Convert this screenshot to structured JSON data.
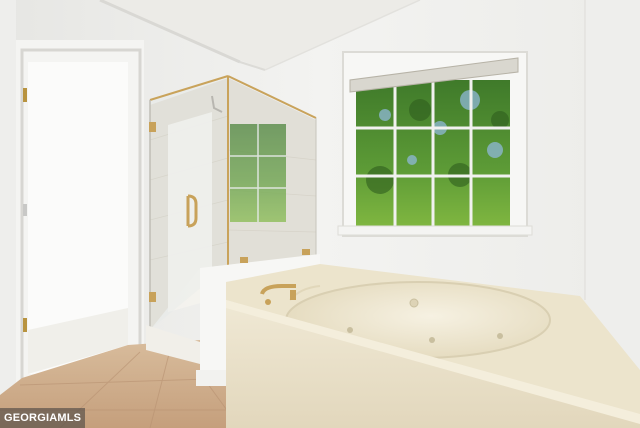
{
  "photo": {
    "subject": "bathroom-with-jetted-tub-and-glass-shower",
    "colors": {
      "wall": "#f2f2f0",
      "ceiling": "#ecebe7",
      "tile_floor": "#c9a887",
      "tub_surround": "#ece4cc",
      "tub_basin": "#efe9d6",
      "glass_frame": "#c8a25a",
      "foliage": "#4f8a2e"
    }
  },
  "watermark": {
    "text": "GEORGIAMLS"
  }
}
